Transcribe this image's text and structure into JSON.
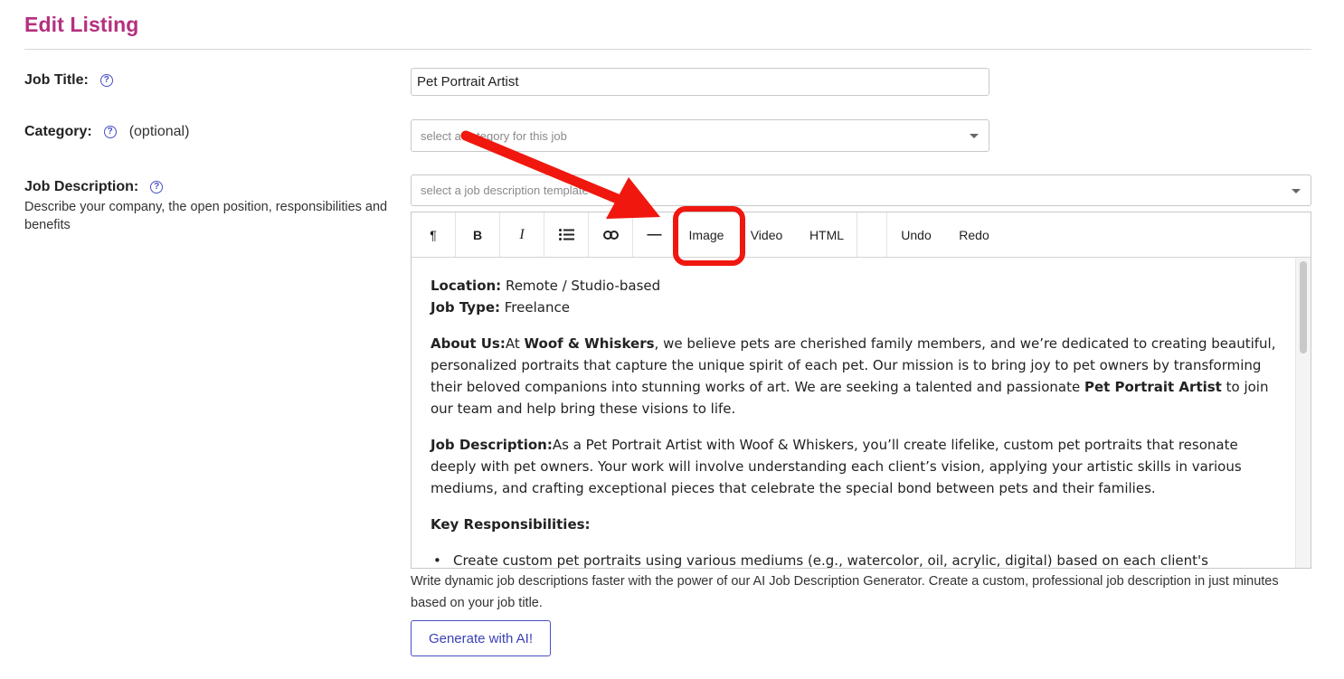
{
  "page": {
    "title": "Edit Listing"
  },
  "job_title": {
    "label": "Job Title:",
    "help_icon": "?",
    "value": "Pet Portrait Artist"
  },
  "category": {
    "label": "Category:",
    "help_icon": "?",
    "optional": "(optional)",
    "placeholder": "select a category for this job"
  },
  "job_description": {
    "label": "Job Description:",
    "help_icon": "?",
    "helper_text": "Describe your company, the open position, responsibilities and benefits",
    "template_placeholder": "select a job description template"
  },
  "toolbar": {
    "paragraph": "¶",
    "bold": "B",
    "italic": "I",
    "list_icon": "list-icon",
    "link_icon": "link-icon",
    "hr": "—",
    "image": "Image",
    "video": "Video",
    "html": "HTML",
    "undo": "Undo",
    "redo": "Redo"
  },
  "content": {
    "location_label": "Location:",
    "location_value": " Remote / Studio-based",
    "jobtype_label": "Job Type:",
    "jobtype_value": " Freelance",
    "about_label": "About Us:",
    "about_1": "At ",
    "about_brand": "Woof & Whiskers",
    "about_2": ", we believe pets are cherished family members, and we’re dedicated to creating beautiful, personalized portraits that capture the unique spirit of each pet. Our mission is to bring joy to pet owners by transforming their beloved companions into stunning works of art. We are seeking a talented and passionate ",
    "about_role": "Pet Portrait Artist",
    "about_3": " to join our team and help bring these visions to life.",
    "desc_label": "Job Description:",
    "desc_text": "As a Pet Portrait Artist with Woof & Whiskers, you’ll create lifelike, custom pet portraits that resonate deeply with pet owners. Your work will involve understanding each client’s vision, applying your artistic skills in various mediums, and crafting exceptional pieces that celebrate the special bond between pets and their families.",
    "resp_label": "Key Responsibilities:",
    "resp_item_1": "Create custom pet portraits using various mediums (e.g., watercolor, oil, acrylic, digital) based on each client's"
  },
  "ai": {
    "note": "Write dynamic job descriptions faster with the power of our AI Job Description Generator. Create a custom, professional job description in just minutes based on your job title.",
    "button": "Generate with AI!"
  },
  "annotation": {
    "color": "#f0170e"
  },
  "colors": {
    "title": "#b5307e",
    "accent": "#4a4fc4"
  }
}
